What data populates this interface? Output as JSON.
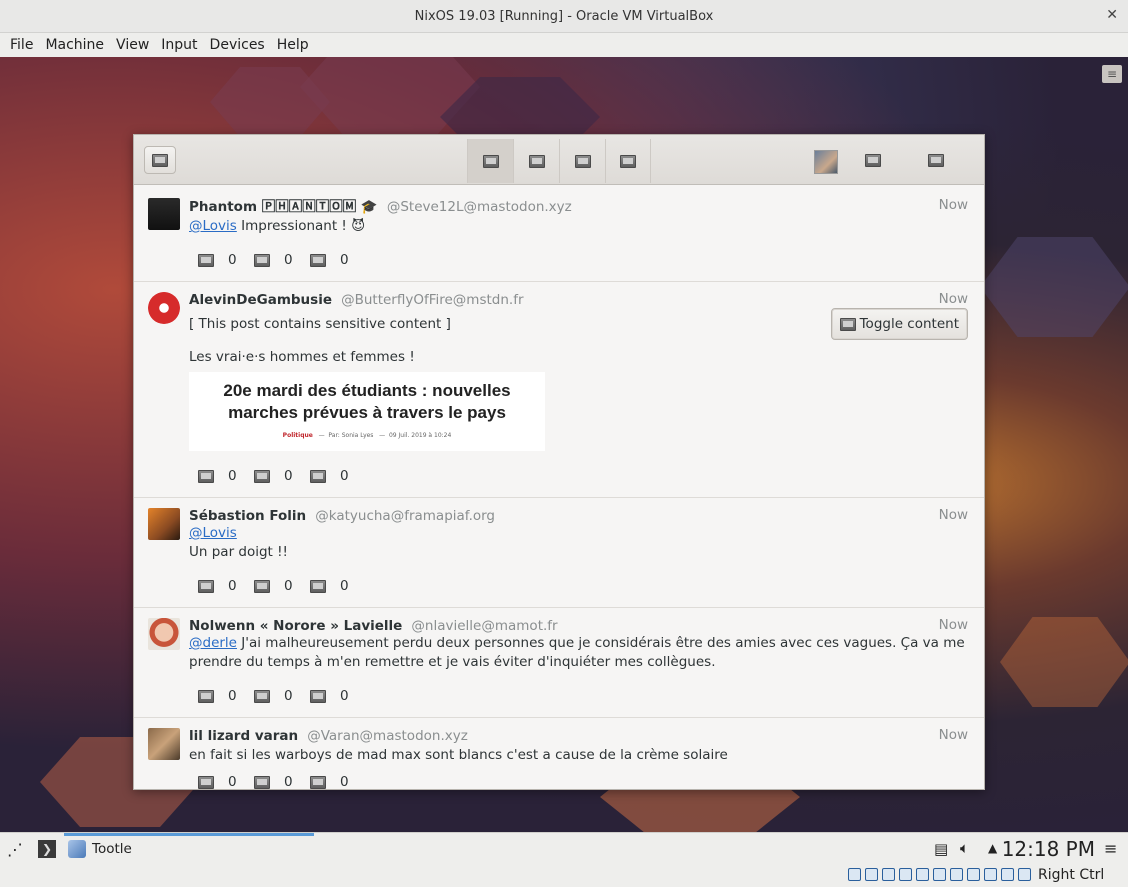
{
  "vbox": {
    "title": "NixOS 19.03 [Running] - Oracle VM VirtualBox",
    "menu": [
      "File",
      "Machine",
      "View",
      "Input",
      "Devices",
      "Help"
    ],
    "host_key": "Right Ctrl"
  },
  "tootle": {
    "posts": [
      {
        "name": "Phantom 🄿🄷🄰🄽🅃🄾🄼 🎓",
        "handle": "@Steve12L@mastodon.xyz",
        "time": "Now",
        "mention": "@Lovis",
        "text": "Impressionant ! 😈",
        "counts": [
          "0",
          "0",
          "0"
        ]
      },
      {
        "name": "AlevinDeGambusie",
        "handle": "@ButterflyOfFire@mstdn.fr",
        "time": "Now",
        "warning": "[ This post contains sensitive content ]",
        "toggle_label": "Toggle content",
        "text": "Les vrai·e·s hommes et femmes !",
        "card_title": "20e mardi des étudiants : nouvelles marches prévues à travers le pays",
        "card_category": "Politique",
        "card_author": "Par: Sonia Lyes",
        "card_date": "09 Juil. 2019 à 10:24",
        "counts": [
          "0",
          "0",
          "0"
        ]
      },
      {
        "name": "Sébastion Folin",
        "handle": "@katyucha@framapiaf.org",
        "time": "Now",
        "mention": "@Lovis",
        "text": "Un par doigt !!",
        "counts": [
          "0",
          "0",
          "0"
        ]
      },
      {
        "name": "Nolwenn « Norore » Lavielle",
        "handle": "@nlavielle@mamot.fr",
        "time": "Now",
        "mention": "@derle",
        "text": "J'ai malheureusement perdu deux personnes que je considérais être des amies avec ces vagues. Ça va me prendre du temps à m'en remettre et je vais éviter d'inquiéter mes collègues.",
        "counts": [
          "0",
          "0",
          "0"
        ]
      },
      {
        "name": "lil lizard varan",
        "handle": "@Varan@mastodon.xyz",
        "time": "Now",
        "text": "en fait si les warboys de mad max sont blancs c'est a cause de la crème solaire",
        "counts": [
          "0",
          "0",
          "0"
        ]
      }
    ]
  },
  "taskbar": {
    "task_label": "Tootle",
    "clock": "12:18 PM"
  }
}
